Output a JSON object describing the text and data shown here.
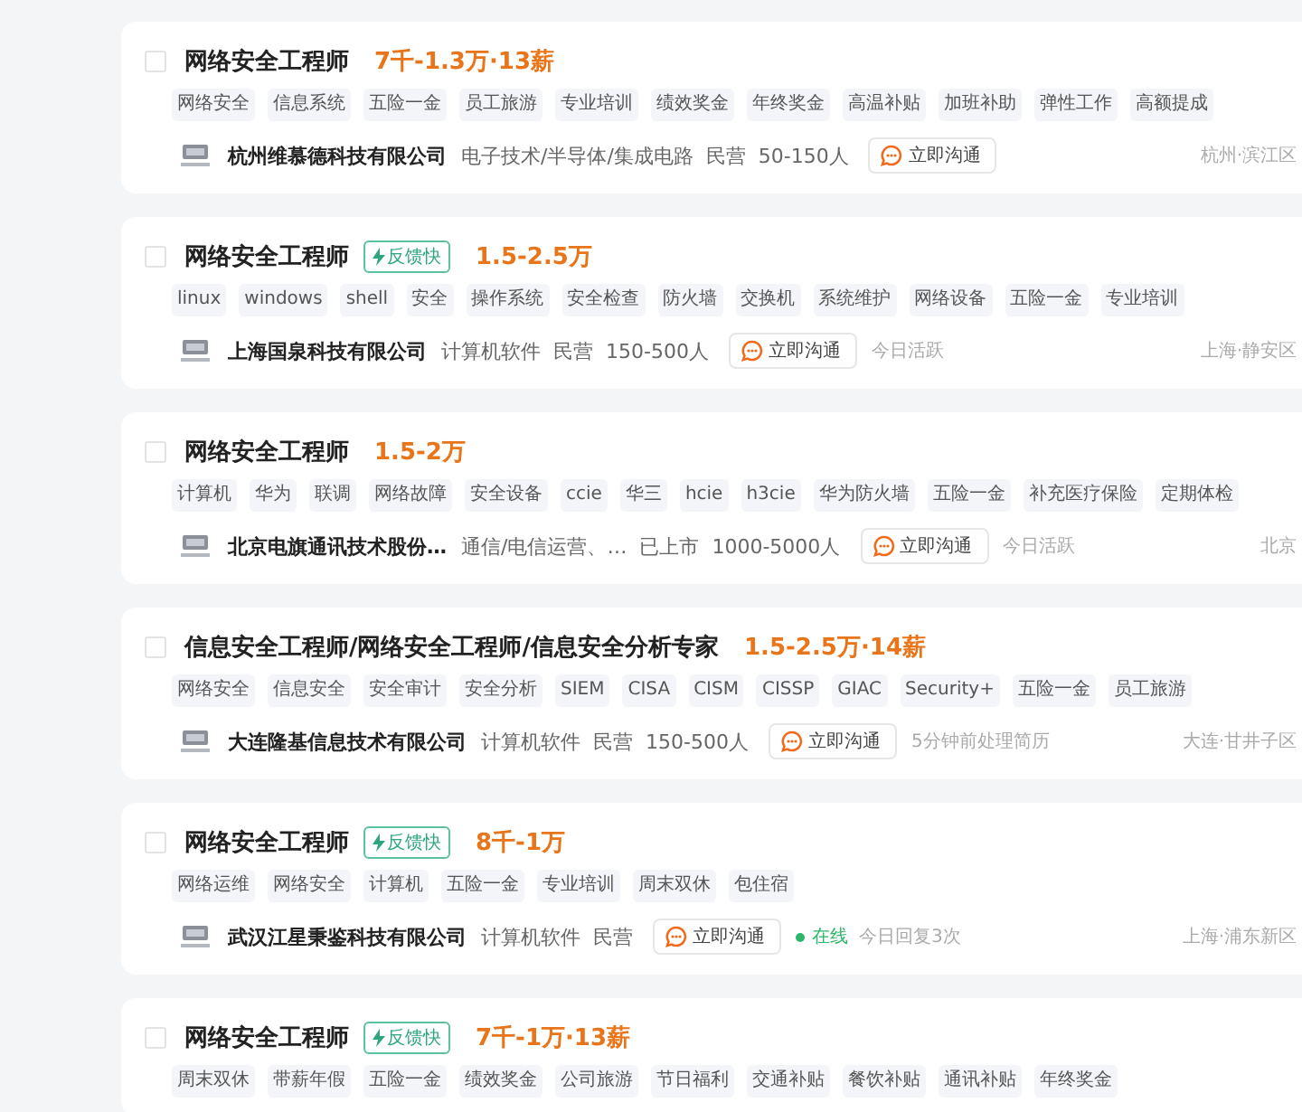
{
  "jobs": [
    {
      "checked": false,
      "title": "网络安全工程师",
      "salary": "7千-1.3万·13薪",
      "tags": [
        "网络安全",
        "信息系统",
        "五险一金",
        "员工旅游",
        "专业培训",
        "绩效奖金",
        "年终奖金",
        "高温补贴",
        "加班补助",
        "弹性工作",
        "高额提成"
      ],
      "company": "杭州维慕德科技有限公司",
      "meta": [
        "电子技术/半导体/集成电路",
        "民营",
        "50-150人"
      ],
      "chat": "立即沟通",
      "location": "杭州·滨江区"
    },
    {
      "checked": false,
      "title": "网络安全工程师",
      "badge": "反馈快",
      "salary": "1.5-2.5万",
      "tags": [
        "linux",
        "windows",
        "shell",
        "安全",
        "操作系统",
        "安全检查",
        "防火墙",
        "交换机",
        "系统维护",
        "网络设备",
        "五险一金",
        "专业培训"
      ],
      "company": "上海国泉科技有限公司",
      "meta": [
        "计算机软件",
        "民营",
        "150-500人"
      ],
      "chat": "立即沟通",
      "activity": "今日活跃",
      "location": "上海·静安区"
    },
    {
      "checked": false,
      "title": "网络安全工程师",
      "salary": "1.5-2万",
      "tags": [
        "计算机",
        "华为",
        "联调",
        "网络故障",
        "安全设备",
        "ccie",
        "华三",
        "hcie",
        "h3cie",
        "华为防火墙",
        "五险一金",
        "补充医疗保险",
        "定期体检"
      ],
      "company": "北京电旗通讯技术股份…",
      "meta": [
        "通信/电信运营、…",
        "已上市",
        "1000-5000人"
      ],
      "chat": "立即沟通",
      "activity": "今日活跃",
      "location": "北京"
    },
    {
      "checked": false,
      "title": "信息安全工程师/网络安全工程师/信息安全分析专家",
      "salary": "1.5-2.5万·14薪",
      "tags": [
        "网络安全",
        "信息安全",
        "安全审计",
        "安全分析",
        "SIEM",
        "CISA",
        "CISM",
        "CISSP",
        "GIAC",
        "Security+",
        "五险一金",
        "员工旅游"
      ],
      "company": "大连隆基信息技术有限公司",
      "meta": [
        "计算机软件",
        "民营",
        "150-500人"
      ],
      "chat": "立即沟通",
      "activity": "5分钟前处理简历",
      "location": "大连·甘井子区"
    },
    {
      "checked": false,
      "title": "网络安全工程师",
      "badge": "反馈快",
      "salary": "8千-1万",
      "tags": [
        "网络运维",
        "网络安全",
        "计算机",
        "五险一金",
        "专业培训",
        "周末双休",
        "包住宿"
      ],
      "company": "武汉江星秉鉴科技有限公司",
      "meta": [
        "计算机软件",
        "民营"
      ],
      "chat": "立即沟通",
      "online": "在线",
      "activity": "今日回复3次",
      "location": "上海·浦东新区"
    },
    {
      "checked": false,
      "title": "网络安全工程师",
      "badge": "反馈快",
      "salary": "7千-1万·13薪",
      "tags": [
        "周末双休",
        "带薪年假",
        "五险一金",
        "绩效奖金",
        "公司旅游",
        "节日福利",
        "交通补贴",
        "餐饮补贴",
        "通讯补贴",
        "年终奖金"
      ]
    }
  ]
}
